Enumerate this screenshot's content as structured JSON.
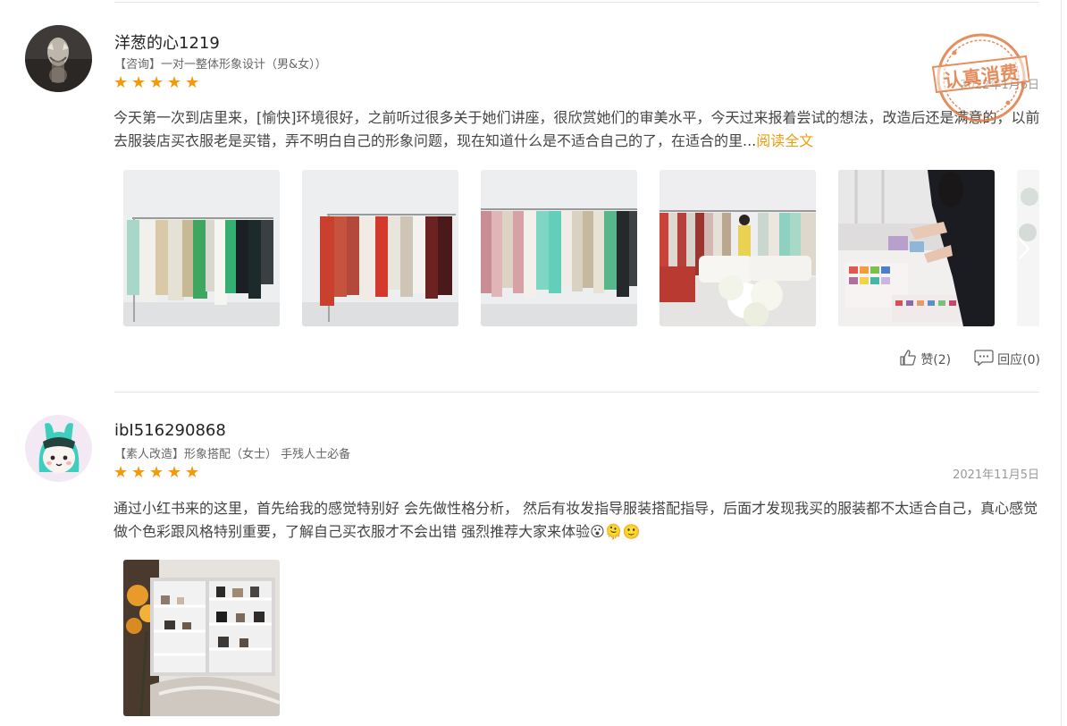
{
  "reviews": [
    {
      "username": "洋葱的心1219",
      "service": "【咨询】一对一整体形象设计（男&女））",
      "rating": 5,
      "date": "2022年1月6日",
      "content": "今天第一次到店里来，[愉快]环境很好，之前听过很多关于她们讲座，很欣赏她们的审美水平，今天过来报着尝试的想法，改造后还是满意的，以前去服装店买衣服老是买错，弄不明白自己的形象问题，现在知道什么是不适合自己的了，在适合的里...",
      "read_more": "阅读全文",
      "stamp_text": "认真消费",
      "like_label": "赞(2)",
      "reply_label": "回应(0)"
    },
    {
      "username": "ibI516290868",
      "service": "【素人改造】形象搭配（女士） 手残人士必备",
      "rating": 5,
      "date": "2021年11月5日",
      "content": "通过小红书来的这里，首先给我的感觉特别好 会先做性格分析， 然后有妆发指导服装搭配指导，后面才发现我买的服装都不太适合自己，真心感觉做个色彩跟风格特别重要，了解自己买衣服才不会出错 强烈推荐大家来体验😮🫠🙂"
    }
  ],
  "icons": {
    "star": "star-icon",
    "like": "thumbs-up-icon",
    "reply": "comment-icon",
    "next": "chevron-right-icon"
  },
  "colors": {
    "star": "#f39a0b",
    "read_more": "#f39a0b",
    "stamp": "#e0763c"
  }
}
